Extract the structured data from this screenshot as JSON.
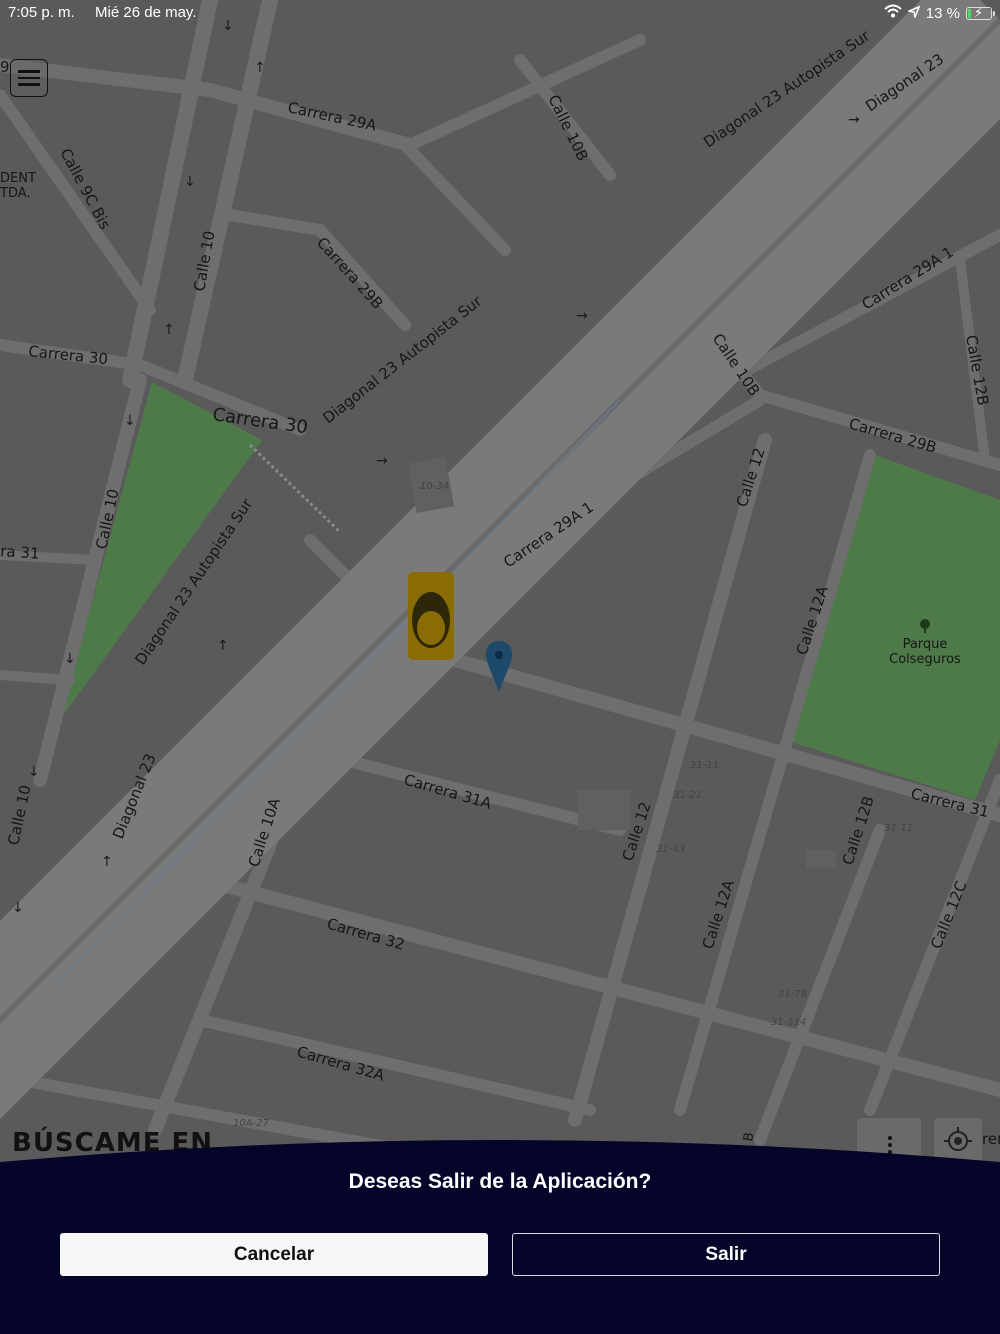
{
  "status_bar": {
    "time": "7:05 p. m.",
    "date": "Mié 26 de may.",
    "battery": "13 %",
    "battery_level": 0.13
  },
  "map": {
    "background": "#5a5a5a",
    "road_color": "#6e6e6e",
    "park_color": "#4e7a4a",
    "labels": {
      "carrera_29a": "Carrera 29A",
      "calle_10b_top": "Calle 10B",
      "diag23_aut_top": "Diagonal 23 Autopista Sur",
      "diag23_top": "Diagonal 23",
      "calle_9c_bis": "Calle 9C Bis",
      "dent": "DENT",
      "tda": "TDA.",
      "calle_10_a": "Calle 10",
      "carrera_29b_a": "Carrera 29B",
      "carrera_29a1_top": "Carrera 29A 1",
      "calle_12b_top": "Calle 12B",
      "carrera_30_a": "Carrera 30",
      "carrera_30_b": "Carrera 30",
      "diag23_aut_mid": "Diagonal 23 Autopista Sur",
      "calle_10b_mid": "Calle 10B",
      "carrera_29b_b": "Carrera 29B",
      "calle_10_b": "Calle 10",
      "calle_12_top": "Calle 12",
      "carrera_31_left": "ra 31",
      "diag23_aut_low": "Diagonal 23 Autopista Sur",
      "carrera_29a1_mid": "Carrera 29A 1",
      "calle_12a_top": "Calle 12A",
      "parque_1": "Parque",
      "parque_2": "Colseguros",
      "carrera_31a": "Carrera 31A",
      "carrera_31": "Carrera 31",
      "calle_10_c": "Calle 10",
      "diag23_low": "Diagonal 23",
      "calle_10a": "Calle 10A",
      "calle_12_low": "Calle 12",
      "calle_12b_low": "Calle 12B",
      "carrera_32": "Carrera 32",
      "calle_12a_low": "Calle 12A",
      "calle_12c": "Calle 12C",
      "carrera_32a": "Carrera 32A",
      "n_10_34": "10-34",
      "n_31_11a": "31-11",
      "n_31_21": "31-21",
      "n_31_43": "31-43",
      "n_31_11b": "31-11",
      "n_31_78": "31-78",
      "n_31_114": "31-114",
      "n_10a_27": "10A-27",
      "b_edge": "B",
      "rer": "rer",
      "nine": "9"
    }
  },
  "brand_text": "BÚSCAME EN",
  "dialog": {
    "title": "Deseas Salir de la Aplicación?",
    "cancel_label": "Cancelar",
    "exit_label": "Salir",
    "background": "#05052a"
  }
}
